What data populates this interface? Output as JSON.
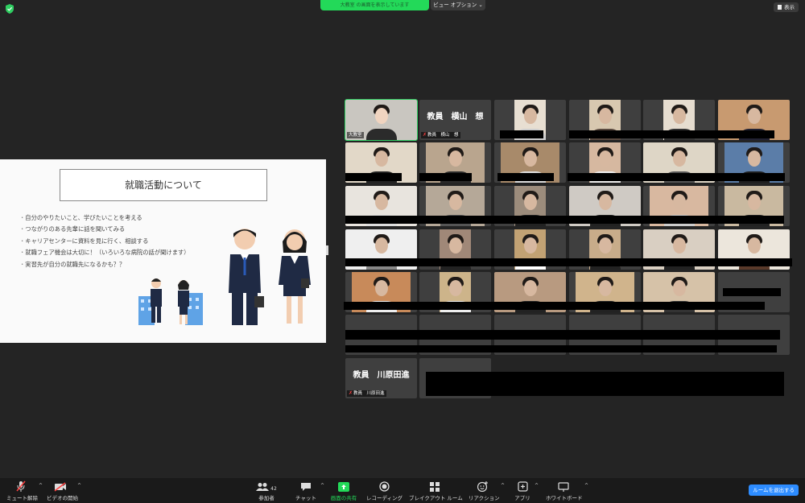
{
  "top": {
    "share_banner": "大教室 の画面を表示しています",
    "view_options": "ビュー オプション",
    "display_button": "表示"
  },
  "slide": {
    "title": "就職活動について",
    "bullets": [
      "自分のやりたいこと、学びたいことを考える",
      "つながりのある先輩に話を聞いてみる",
      "キャリアセンターに資料を見に行く、相談する",
      "就職フェア機会は大切に！（いろいろな病院の話が聞けます）",
      "実習先が自分の就職先になるかも？？"
    ]
  },
  "participants": {
    "active_name": "大教室",
    "teacher1_big": "教員　横山　想",
    "teacher1_small": "教員　横山　想",
    "teacher2_big": "教員　川原田進",
    "teacher2_small": "教員　川原田進"
  },
  "toolbar": {
    "mute": "ミュート解除",
    "video": "ビデオの開始",
    "participants": "参加者",
    "participants_count": "42",
    "chat": "チャット",
    "share": "画面の共有",
    "record": "レコーディング",
    "breakout": "ブレイクアウト ルーム",
    "reactions": "リアクション",
    "apps": "アプリ",
    "whiteboard": "ホワイトボード",
    "leave": "ルームを退出する"
  },
  "colors": {
    "background": "#242424",
    "active_border": "#2fce61",
    "share_banner": "#23d959",
    "leave_button": "#2d8cff",
    "muted": "#ff4040"
  }
}
